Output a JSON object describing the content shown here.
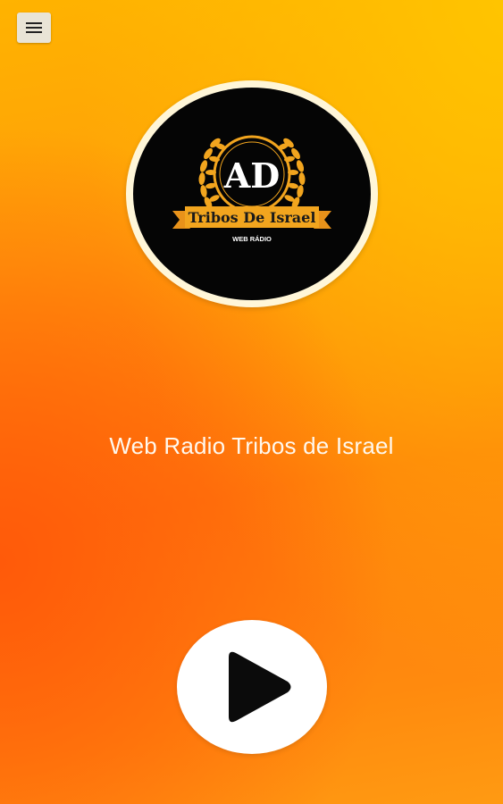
{
  "menu": {
    "icon": "hamburger-menu-icon"
  },
  "logo": {
    "monogram": "AD",
    "banner_text": "Tribos De Israel",
    "subtitle": "WEB RÁDIO",
    "colors": {
      "background": "#050505",
      "ring": "#fff6d8",
      "gold": "#f2a51e"
    }
  },
  "station": {
    "title": "Web Radio Tribos de Israel"
  },
  "player": {
    "play_icon": "play-icon",
    "state": "paused"
  },
  "theme": {
    "gradient_top": "#ffc000",
    "gradient_bottom": "#ff6a08",
    "title_color": "#fff8ee"
  }
}
